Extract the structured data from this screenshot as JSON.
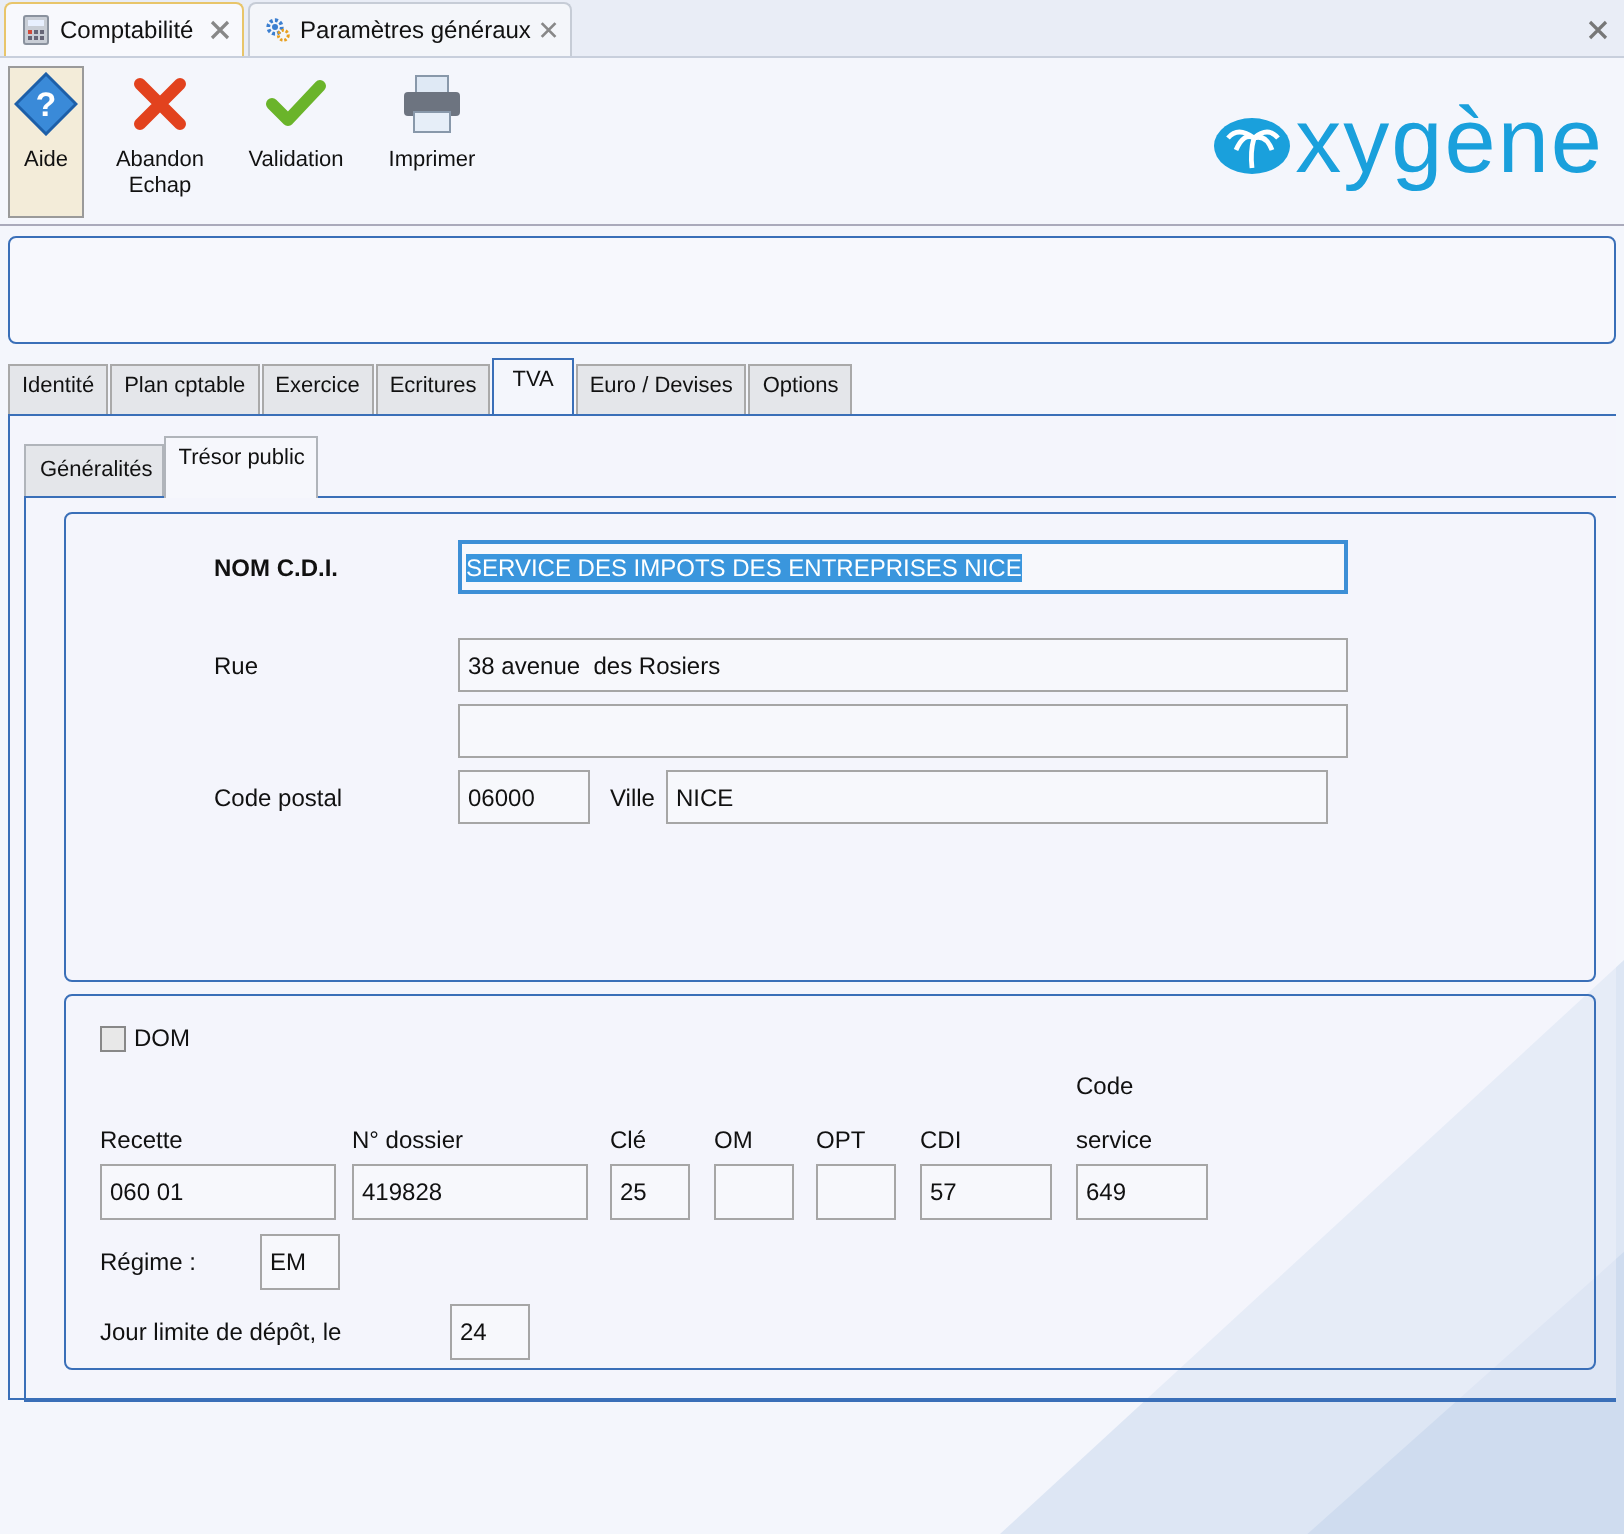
{
  "doc_tabs": [
    {
      "label": "Comptabilité",
      "selected": true,
      "kind": "calc"
    },
    {
      "label": "Paramètres généraux",
      "selected": false,
      "kind": "gear"
    }
  ],
  "toolbar": [
    {
      "kind": "help",
      "lines": [
        "Aide"
      ],
      "pressed": true,
      "glyph": "?"
    },
    {
      "kind": "cancel",
      "lines": [
        "Abandon",
        "Echap"
      ],
      "pressed": false
    },
    {
      "kind": "ok",
      "lines": [
        "Validation"
      ],
      "pressed": false
    },
    {
      "kind": "print",
      "lines": [
        "Imprimer"
      ],
      "pressed": false
    }
  ],
  "logo": {
    "text": "xygène"
  },
  "tabs": [
    {
      "label": "Identité",
      "selected": false
    },
    {
      "label": "Plan cptable",
      "selected": false
    },
    {
      "label": "Exercice",
      "selected": false
    },
    {
      "label": "Ecritures",
      "selected": false
    },
    {
      "label": "TVA",
      "selected": true
    },
    {
      "label": "Euro / Devises",
      "selected": false
    },
    {
      "label": "Options",
      "selected": false
    }
  ],
  "sub_tabs": [
    {
      "label": "Généralités",
      "selected": false
    },
    {
      "label": "Trésor public",
      "selected": true
    }
  ],
  "address": {
    "nom": {
      "label": "NOM C.D.I.",
      "value": "SERVICE DES IMPOTS DES ENTREPRISES NICE",
      "focused": true
    },
    "rue": {
      "label": "Rue",
      "value": "38 avenue  des Rosiers"
    },
    "code_postal": {
      "label": "Code postal",
      "value": "06000"
    },
    "ville": {
      "label": "Ville",
      "value": "NICE"
    }
  },
  "dom": {
    "label": "DOM",
    "checked": false
  },
  "codes": [
    {
      "label": [
        "Recette"
      ],
      "value": "060 01"
    },
    {
      "label": [
        "N° dossier"
      ],
      "value": "419828"
    },
    {
      "label": [
        "Clé"
      ],
      "value": "25"
    },
    {
      "label": [
        "OM"
      ]
    },
    {
      "label": [
        "OPT"
      ]
    },
    {
      "label": [
        "CDI"
      ],
      "value": "57"
    },
    {
      "label": [
        "Code",
        "service"
      ],
      "value": "649"
    }
  ],
  "regime": {
    "label": "Régime :",
    "value": "EM"
  },
  "jour_limite": {
    "label": "Jour limite de dépôt, le",
    "value": "24"
  }
}
